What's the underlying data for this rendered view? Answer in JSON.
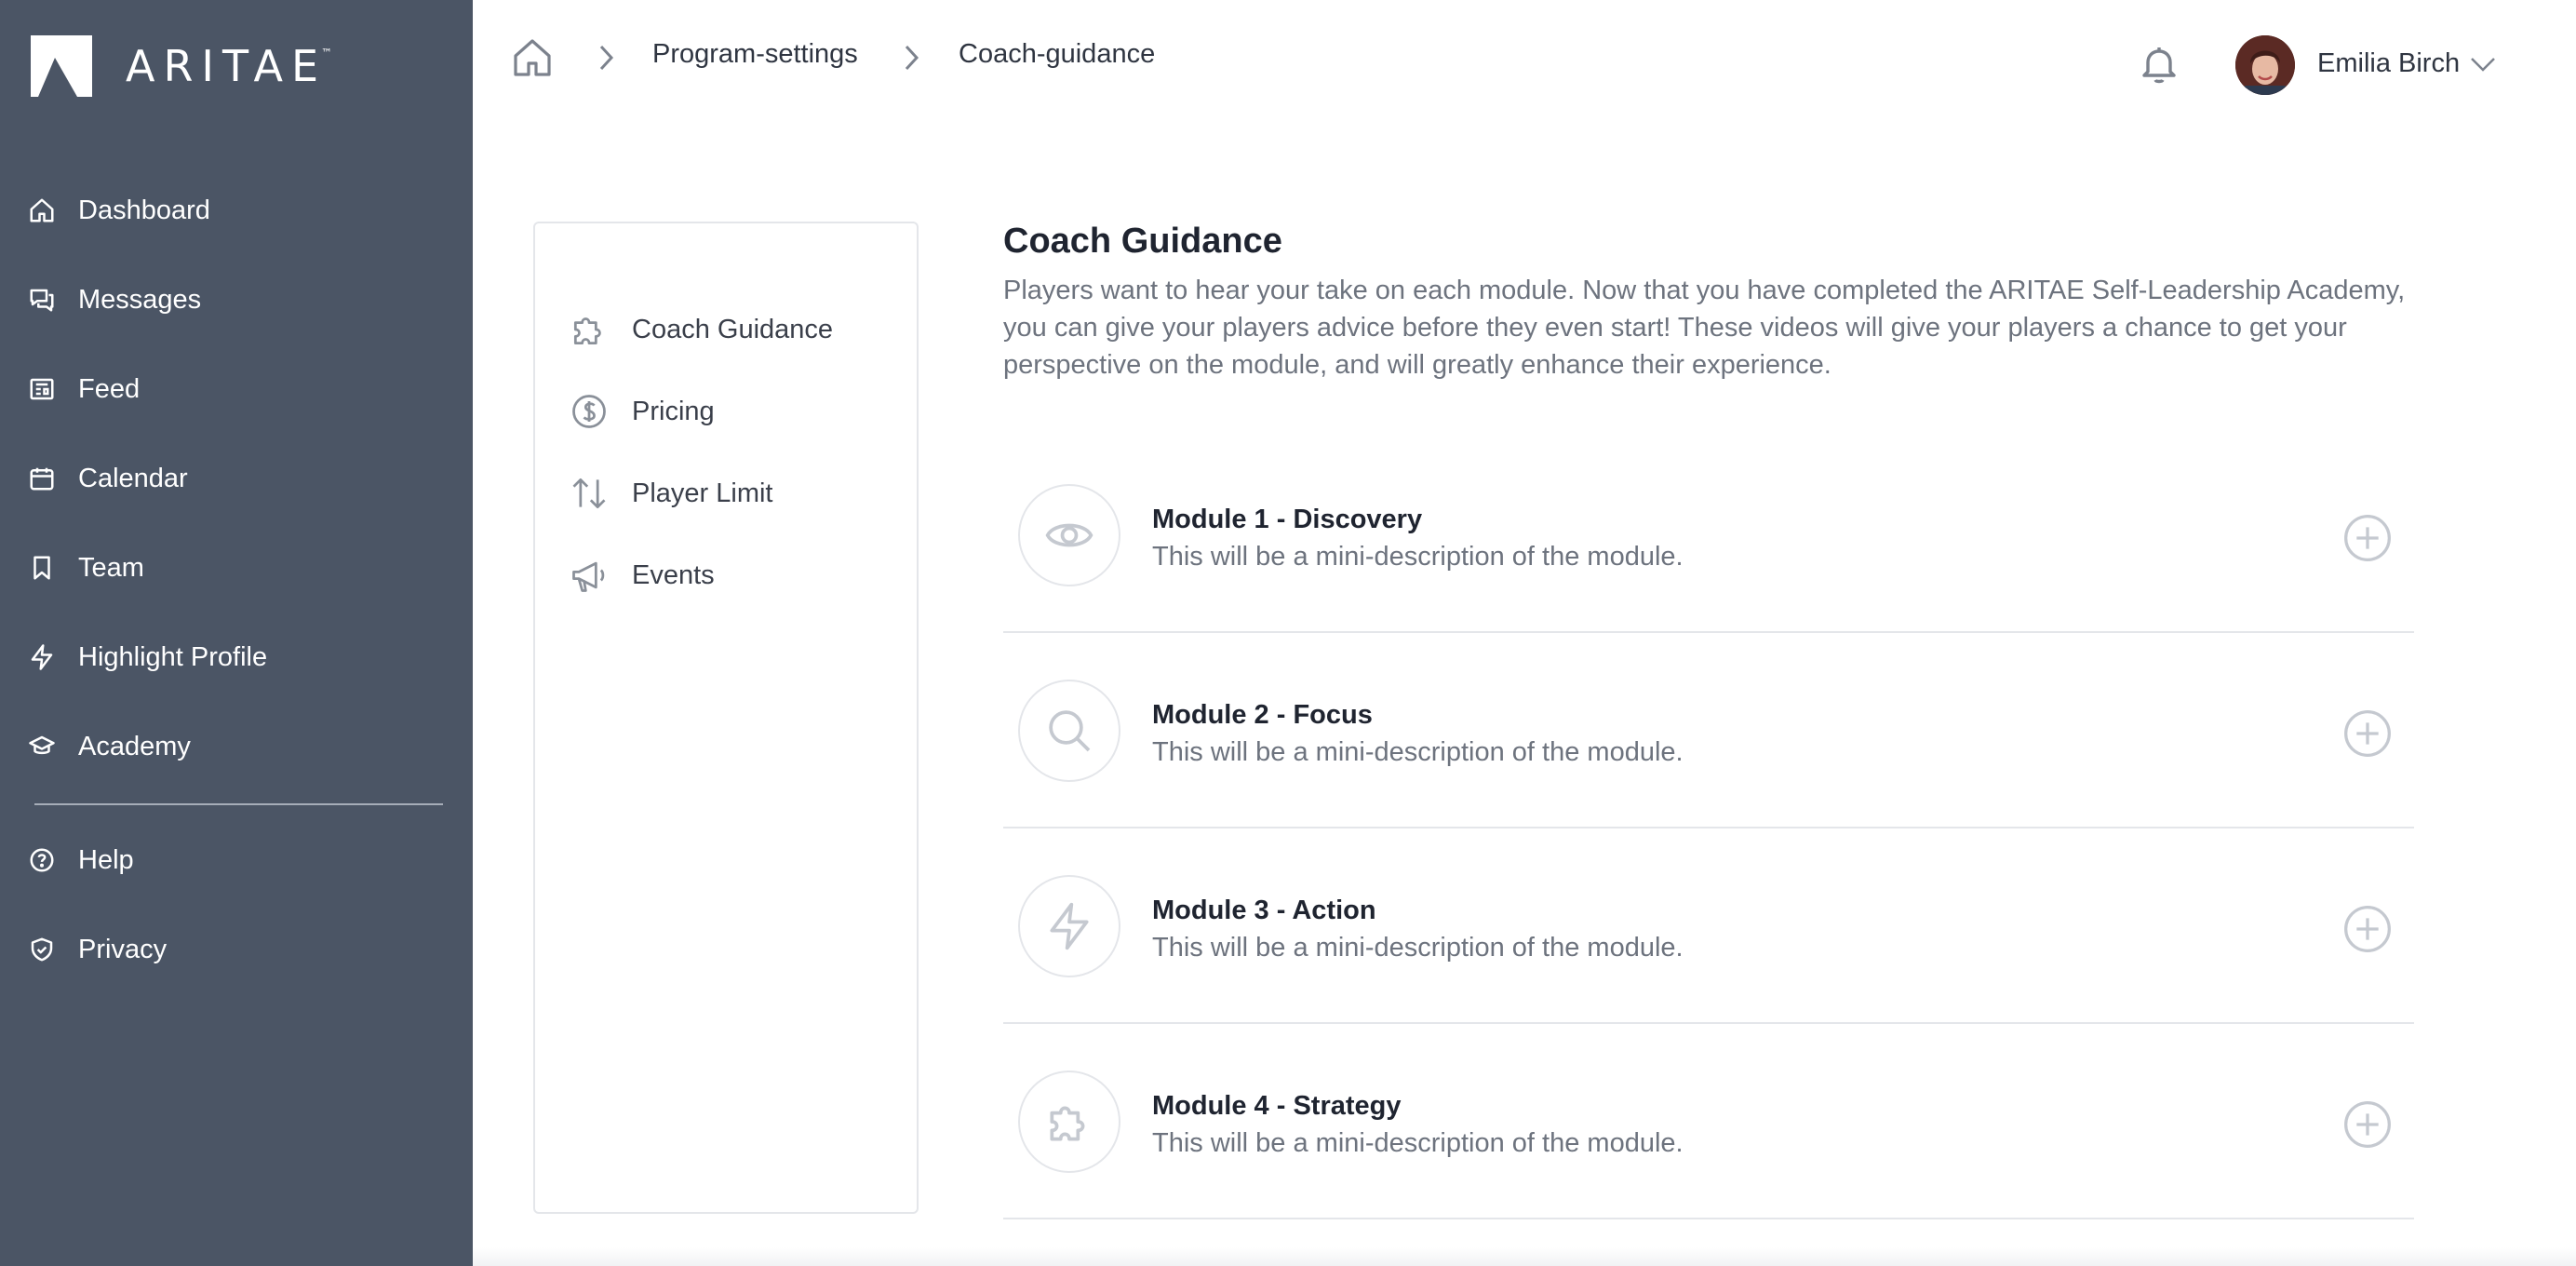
{
  "brand": {
    "name": "ARITAE",
    "trademark": "™"
  },
  "sidebar": {
    "items": [
      {
        "label": "Dashboard",
        "icon": "home-icon"
      },
      {
        "label": "Messages",
        "icon": "messages-icon"
      },
      {
        "label": "Feed",
        "icon": "feed-icon"
      },
      {
        "label": "Calendar",
        "icon": "calendar-icon"
      },
      {
        "label": "Team",
        "icon": "bookmark-icon"
      },
      {
        "label": "Highlight Profile",
        "icon": "lightning-icon"
      },
      {
        "label": "Academy",
        "icon": "graduation-cap-icon"
      }
    ],
    "secondary": [
      {
        "label": "Help",
        "icon": "help-circle-icon"
      },
      {
        "label": "Privacy",
        "icon": "shield-check-icon"
      }
    ]
  },
  "breadcrumb": {
    "items": [
      "Program-settings",
      "Coach-guidance"
    ]
  },
  "user": {
    "name": "Emilia Birch"
  },
  "settings_nav": {
    "items": [
      {
        "label": "Coach Guidance",
        "icon": "puzzle-icon"
      },
      {
        "label": "Pricing",
        "icon": "dollar-circle-icon"
      },
      {
        "label": "Player Limit",
        "icon": "arrows-up-down-icon"
      },
      {
        "label": "Events",
        "icon": "megaphone-icon"
      }
    ]
  },
  "main": {
    "title": "Coach Guidance",
    "description": "Players want to hear your take on each module. Now that you have completed the ARITAE Self-Leadership Academy, you can give your players advice before they even start! These videos will give your players a chance to get your perspective on the module, and will greatly enhance their experience.",
    "modules": [
      {
        "title": "Module 1 - Discovery",
        "description": "This will be a mini-description of the module.",
        "icon": "eye-icon"
      },
      {
        "title": "Module 2 - Focus",
        "description": "This will be a mini-description of the module.",
        "icon": "search-icon"
      },
      {
        "title": "Module 3 - Action",
        "description": "This will be a mini-description of the module.",
        "icon": "lightning-icon"
      },
      {
        "title": "Module 4 - Strategy",
        "description": "This will be a mini-description of the module.",
        "icon": "puzzle-icon"
      }
    ]
  },
  "colors": {
    "sidebar_bg": "#4b5565",
    "border": "#e4e6ea",
    "icon_gray": "#c5c9d0",
    "text_dark": "#1f2430",
    "text_muted": "#6d737e"
  }
}
